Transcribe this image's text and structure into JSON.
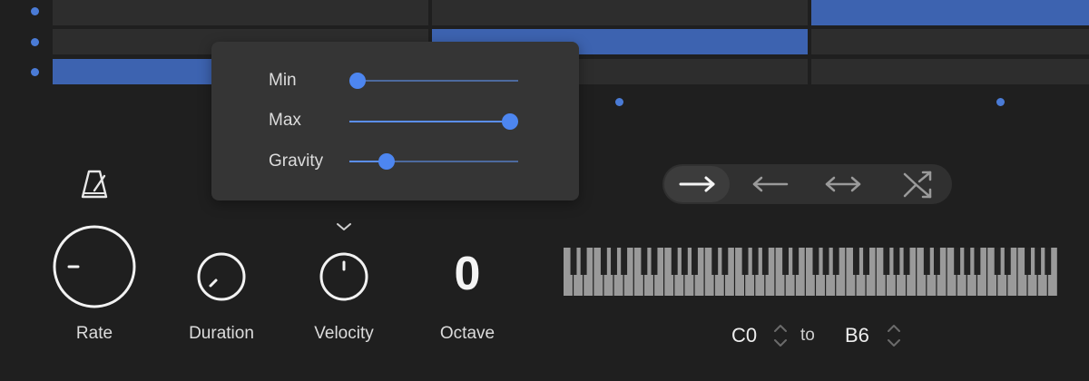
{
  "popover": {
    "sliders": [
      {
        "label": "Min",
        "value": 0.05
      },
      {
        "label": "Max",
        "value": 0.95
      },
      {
        "label": "Gravity",
        "value": 0.22
      }
    ]
  },
  "controls": {
    "rate_label": "Rate",
    "duration_label": "Duration",
    "velocity_label": "Velocity",
    "octave_label": "Octave",
    "octave_value": "0"
  },
  "direction": {
    "options": [
      "forward-arrow-icon",
      "backward-arrow-icon",
      "bidirectional-arrow-icon",
      "shuffle-icon"
    ],
    "selected": "forward-arrow-icon"
  },
  "range": {
    "from": "C0",
    "to_label": "to",
    "to": "B6"
  },
  "colors": {
    "accent": "#4a7bd6",
    "active_cell": "#3d63b0",
    "background": "#1f1f1f"
  }
}
